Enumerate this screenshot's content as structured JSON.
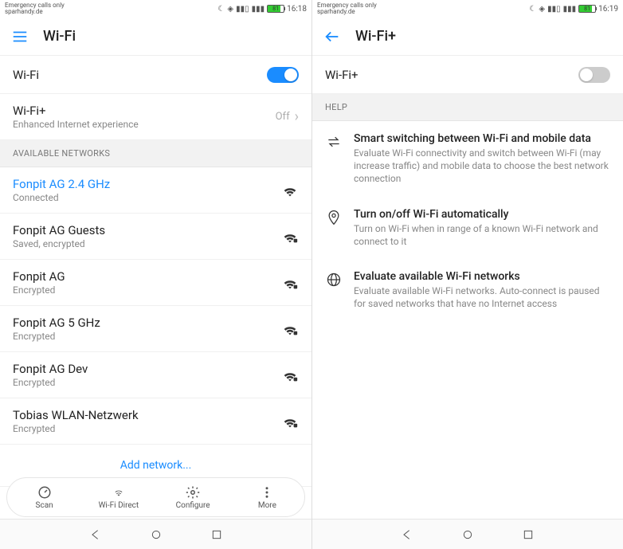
{
  "left": {
    "status": {
      "carrier": "Emergency calls only",
      "sub": "sparhandy.de",
      "battery": "81",
      "time": "16:18"
    },
    "appbar": {
      "title": "Wi-Fi"
    },
    "wifi_toggle": {
      "label": "Wi-Fi",
      "on": true
    },
    "wifi_plus": {
      "title": "Wi-Fi+",
      "subtitle": "Enhanced Internet experience",
      "value": "Off"
    },
    "section": "AVAILABLE NETWORKS",
    "networks": [
      {
        "name": "Fonpit AG 2.4 GHz",
        "status": "Connected",
        "connected": true
      },
      {
        "name": "Fonpit AG Guests",
        "status": "Saved, encrypted"
      },
      {
        "name": "Fonpit AG",
        "status": "Encrypted"
      },
      {
        "name": "Fonpit AG 5 GHz",
        "status": "Encrypted"
      },
      {
        "name": "Fonpit AG Dev",
        "status": "Encrypted"
      },
      {
        "name": "Tobias WLAN-Netzwerk",
        "status": "Encrypted"
      }
    ],
    "add_network": "Add network...",
    "bottom": [
      {
        "label": "Scan"
      },
      {
        "label": "Wi-Fi Direct"
      },
      {
        "label": "Configure"
      },
      {
        "label": "More"
      }
    ]
  },
  "right": {
    "status": {
      "carrier": "Emergency calls only",
      "sub": "sparhandy.de",
      "battery": "81",
      "time": "16:19"
    },
    "appbar": {
      "title": "Wi-Fi+"
    },
    "wifi_plus_toggle": {
      "label": "Wi-Fi+",
      "on": false
    },
    "help_section": "HELP",
    "help": [
      {
        "title": "Smart switching between Wi-Fi and mobile data",
        "desc": "Evaluate Wi-Fi connectivity and switch between Wi-Fi (may increase traffic) and mobile data to choose the best network connection"
      },
      {
        "title": "Turn on/off Wi-Fi automatically",
        "desc": "Turn on Wi-Fi when in range of a known Wi-Fi network and connect to it"
      },
      {
        "title": "Evaluate available Wi-Fi networks",
        "desc": "Evaluate available Wi-Fi networks. Auto-connect is paused for saved networks that have no Internet access"
      }
    ]
  }
}
